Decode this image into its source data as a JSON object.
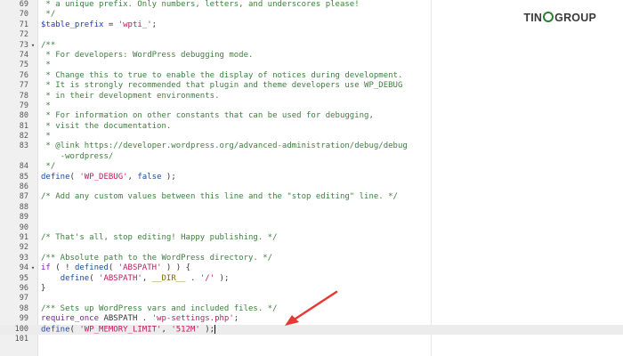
{
  "editor": {
    "active_line": 100,
    "lines": [
      {
        "num": "69",
        "fold": "",
        "tokens": [
          {
            "t": " * a unique prefix. Only numbers, letters, and underscores please!",
            "c": "c-comment"
          }
        ]
      },
      {
        "num": "70",
        "fold": "",
        "tokens": [
          {
            "t": " */",
            "c": "c-comment"
          }
        ]
      },
      {
        "num": "71",
        "fold": "",
        "tokens": [
          {
            "t": "$table_prefix",
            "c": "c-var"
          },
          {
            "t": " = ",
            "c": "c-plain"
          },
          {
            "t": "'wpti_'",
            "c": "c-string"
          },
          {
            "t": ";",
            "c": "c-plain"
          }
        ]
      },
      {
        "num": "72",
        "fold": "",
        "tokens": []
      },
      {
        "num": "73",
        "fold": "▾",
        "tokens": [
          {
            "t": "/**",
            "c": "c-comment"
          }
        ]
      },
      {
        "num": "74",
        "fold": "",
        "tokens": [
          {
            "t": " * For developers: WordPress debugging mode.",
            "c": "c-comment"
          }
        ]
      },
      {
        "num": "75",
        "fold": "",
        "tokens": [
          {
            "t": " *",
            "c": "c-comment"
          }
        ]
      },
      {
        "num": "76",
        "fold": "",
        "tokens": [
          {
            "t": " * Change this to true to enable the display of notices during development.",
            "c": "c-comment"
          }
        ]
      },
      {
        "num": "77",
        "fold": "",
        "tokens": [
          {
            "t": " * It is strongly recommended that plugin and theme developers use WP_DEBUG",
            "c": "c-comment"
          }
        ]
      },
      {
        "num": "78",
        "fold": "",
        "tokens": [
          {
            "t": " * in their development environments.",
            "c": "c-comment"
          }
        ]
      },
      {
        "num": "79",
        "fold": "",
        "tokens": [
          {
            "t": " *",
            "c": "c-comment"
          }
        ]
      },
      {
        "num": "80",
        "fold": "",
        "tokens": [
          {
            "t": " * For information on other constants that can be used for debugging,",
            "c": "c-comment"
          }
        ]
      },
      {
        "num": "81",
        "fold": "",
        "tokens": [
          {
            "t": " * visit the documentation.",
            "c": "c-comment"
          }
        ]
      },
      {
        "num": "82",
        "fold": "",
        "tokens": [
          {
            "t": " *",
            "c": "c-comment"
          }
        ]
      },
      {
        "num": "83",
        "fold": "",
        "tokens": [
          {
            "t": " * @link https://developer.wordpress.org/advanced-administration/debug/debug",
            "c": "c-comment"
          }
        ]
      },
      {
        "num": "",
        "fold": "",
        "tokens": [
          {
            "t": "    -wordpress/",
            "c": "c-comment"
          }
        ]
      },
      {
        "num": "84",
        "fold": "",
        "tokens": [
          {
            "t": " */",
            "c": "c-comment"
          }
        ]
      },
      {
        "num": "85",
        "fold": "",
        "tokens": [
          {
            "t": "define",
            "c": "c-def"
          },
          {
            "t": "( ",
            "c": "c-plain"
          },
          {
            "t": "'WP_DEBUG'",
            "c": "c-string"
          },
          {
            "t": ", ",
            "c": "c-plain"
          },
          {
            "t": "false",
            "c": "c-bool"
          },
          {
            "t": " );",
            "c": "c-plain"
          }
        ]
      },
      {
        "num": "86",
        "fold": "",
        "tokens": []
      },
      {
        "num": "87",
        "fold": "",
        "tokens": [
          {
            "t": "/* Add any custom values between this line and the \"stop editing\" line. */",
            "c": "c-comment"
          }
        ]
      },
      {
        "num": "88",
        "fold": "",
        "tokens": []
      },
      {
        "num": "89",
        "fold": "",
        "tokens": []
      },
      {
        "num": "90",
        "fold": "",
        "tokens": []
      },
      {
        "num": "91",
        "fold": "",
        "tokens": [
          {
            "t": "/* That's all, stop editing! Happy publishing. */",
            "c": "c-comment"
          }
        ]
      },
      {
        "num": "92",
        "fold": "",
        "tokens": []
      },
      {
        "num": "93",
        "fold": "",
        "tokens": [
          {
            "t": "/** Absolute path to the WordPress directory. */",
            "c": "c-comment"
          }
        ]
      },
      {
        "num": "94",
        "fold": "▾",
        "tokens": [
          {
            "t": "if",
            "c": "c-kw"
          },
          {
            "t": " ( ! ",
            "c": "c-plain"
          },
          {
            "t": "defined",
            "c": "c-def"
          },
          {
            "t": "( ",
            "c": "c-plain"
          },
          {
            "t": "'ABSPATH'",
            "c": "c-string"
          },
          {
            "t": " ) ) {",
            "c": "c-plain"
          }
        ]
      },
      {
        "num": "95",
        "fold": "",
        "tokens": [
          {
            "t": "    ",
            "c": "c-plain"
          },
          {
            "t": "define",
            "c": "c-def"
          },
          {
            "t": "( ",
            "c": "c-plain"
          },
          {
            "t": "'ABSPATH'",
            "c": "c-string"
          },
          {
            "t": ", ",
            "c": "c-plain"
          },
          {
            "t": "__DIR__",
            "c": "c-const"
          },
          {
            "t": " . ",
            "c": "c-plain"
          },
          {
            "t": "'/'",
            "c": "c-string"
          },
          {
            "t": " );",
            "c": "c-plain"
          }
        ]
      },
      {
        "num": "96",
        "fold": "",
        "tokens": [
          {
            "t": "}",
            "c": "c-plain"
          }
        ]
      },
      {
        "num": "97",
        "fold": "",
        "tokens": []
      },
      {
        "num": "98",
        "fold": "",
        "tokens": [
          {
            "t": "/** Sets up WordPress vars and included files. */",
            "c": "c-comment"
          }
        ]
      },
      {
        "num": "99",
        "fold": "",
        "tokens": [
          {
            "t": "require_once",
            "c": "c-kw"
          },
          {
            "t": " ABSPATH . ",
            "c": "c-plain"
          },
          {
            "t": "'wp-settings.php'",
            "c": "c-string"
          },
          {
            "t": ";",
            "c": "c-plain"
          }
        ]
      },
      {
        "num": "100",
        "fold": "",
        "tokens": [
          {
            "t": "define",
            "c": "c-def"
          },
          {
            "t": "( ",
            "c": "c-plain"
          },
          {
            "t": "'WP_MEMORY_LIMIT'",
            "c": "c-string"
          },
          {
            "t": ", ",
            "c": "c-plain"
          },
          {
            "t": "'512M'",
            "c": "c-string"
          },
          {
            "t": " );",
            "c": "c-plain"
          }
        ]
      },
      {
        "num": "101",
        "fold": "",
        "tokens": []
      }
    ]
  },
  "watermark": {
    "text_before": "TIN",
    "text_after": "GROUP",
    "accent_color": "#2e7d32"
  },
  "annotation": {
    "arrow_color": "#e53935"
  }
}
